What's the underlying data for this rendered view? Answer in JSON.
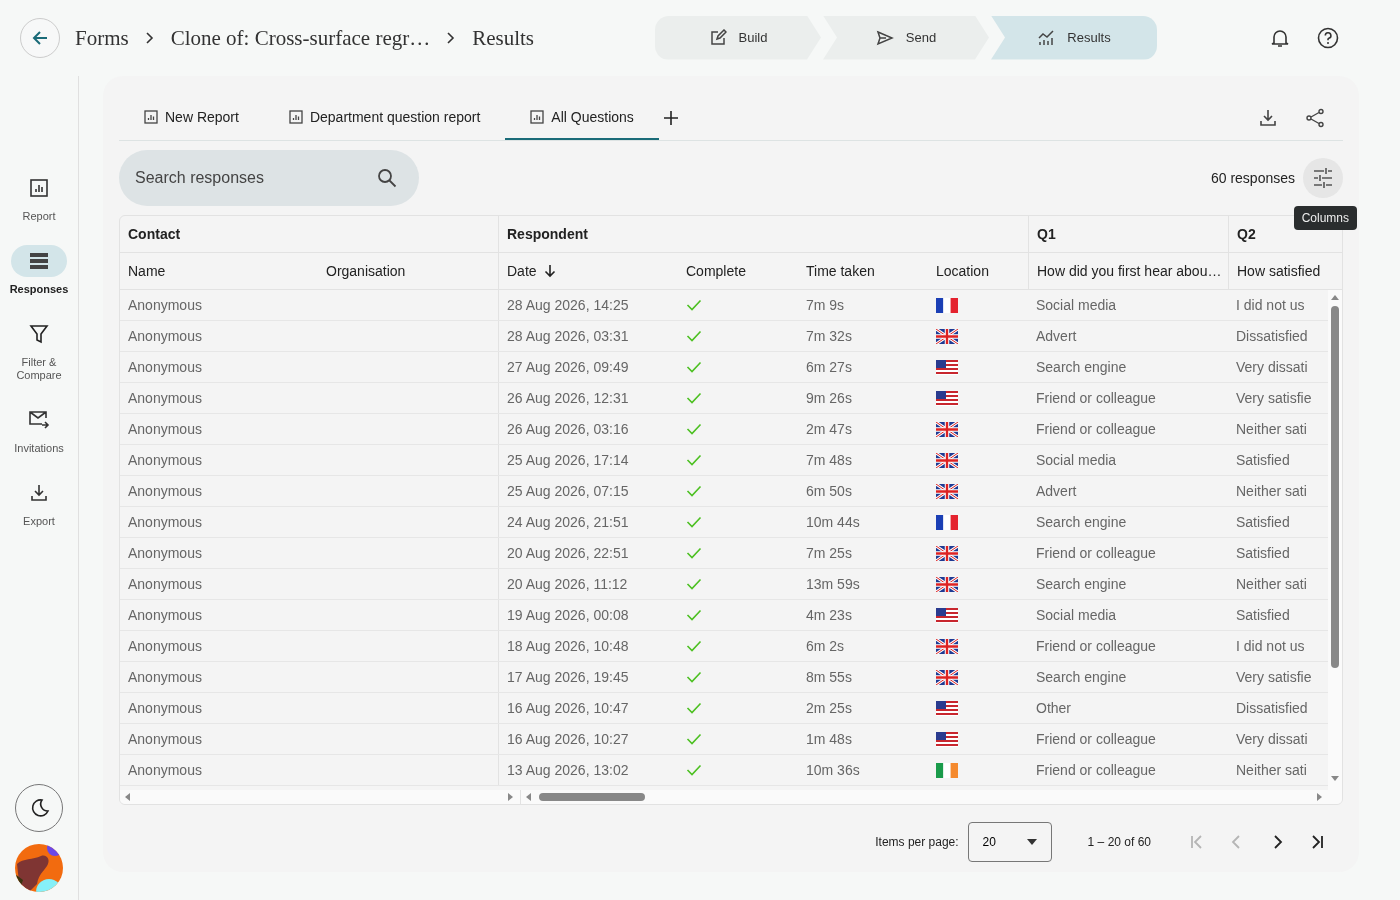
{
  "breadcrumb": [
    "Forms",
    "Clone of: Cross-surface regr…",
    "Results"
  ],
  "steps": [
    {
      "kind": "build",
      "label": "Build",
      "selected": false
    },
    {
      "kind": "send",
      "label": "Send",
      "selected": false
    },
    {
      "kind": "results",
      "label": "Results",
      "selected": true
    }
  ],
  "sidebar": {
    "items": [
      {
        "kind": "report",
        "label": "Report",
        "selected": false
      },
      {
        "kind": "responses",
        "label": "Responses",
        "selected": true
      },
      {
        "kind": "filter",
        "label": "Filter & Compare",
        "selected": false
      },
      {
        "kind": "invitations",
        "label": "Invitations",
        "selected": false
      },
      {
        "kind": "export",
        "label": "Export",
        "selected": false
      }
    ]
  },
  "tabs": [
    {
      "label": "New Report",
      "selected": false
    },
    {
      "label": "Department question report",
      "selected": false
    },
    {
      "label": "All Questions",
      "selected": true
    }
  ],
  "search": {
    "placeholder": "Search responses"
  },
  "response_count": "60 responses",
  "tooltip": "Columns",
  "table": {
    "groups": [
      {
        "label": "Contact"
      },
      {
        "label": "Respondent"
      },
      {
        "label": "Q1"
      },
      {
        "label": "Q2"
      }
    ],
    "columns": [
      {
        "label": "Name",
        "sorted": false
      },
      {
        "label": "Organisation",
        "sorted": false
      },
      {
        "label": "Date",
        "sorted": true
      },
      {
        "label": "Complete",
        "sorted": false
      },
      {
        "label": "Time taken",
        "sorted": false
      },
      {
        "label": "Location",
        "sorted": false
      },
      {
        "label": "How did you first hear abou…",
        "sorted": false
      },
      {
        "label": "How satisfied",
        "sorted": false
      }
    ],
    "rows": [
      {
        "name": "Anonymous",
        "date": "28 Aug 2026, 14:25",
        "complete": true,
        "time": "7m 9s",
        "location": {
          "kind": "fr"
        },
        "q1": "Social media",
        "q2": "I did not us"
      },
      {
        "name": "Anonymous",
        "date": "28 Aug 2026, 03:31",
        "complete": true,
        "time": "7m 32s",
        "location": {
          "kind": "gb"
        },
        "q1": "Advert",
        "q2": "Dissatisfied"
      },
      {
        "name": "Anonymous",
        "date": "27 Aug 2026, 09:49",
        "complete": true,
        "time": "6m 27s",
        "location": {
          "kind": "us"
        },
        "q1": "Search engine",
        "q2": "Very dissati"
      },
      {
        "name": "Anonymous",
        "date": "26 Aug 2026, 12:31",
        "complete": true,
        "time": "9m 26s",
        "location": {
          "kind": "us"
        },
        "q1": "Friend or colleague",
        "q2": "Very satisfie"
      },
      {
        "name": "Anonymous",
        "date": "26 Aug 2026, 03:16",
        "complete": true,
        "time": "2m 47s",
        "location": {
          "kind": "gb"
        },
        "q1": "Friend or colleague",
        "q2": "Neither sati"
      },
      {
        "name": "Anonymous",
        "date": "25 Aug 2026, 17:14",
        "complete": true,
        "time": "7m 48s",
        "location": {
          "kind": "gb"
        },
        "q1": "Social media",
        "q2": "Satisfied"
      },
      {
        "name": "Anonymous",
        "date": "25 Aug 2026, 07:15",
        "complete": true,
        "time": "6m 50s",
        "location": {
          "kind": "gb"
        },
        "q1": "Advert",
        "q2": "Neither sati"
      },
      {
        "name": "Anonymous",
        "date": "24 Aug 2026, 21:51",
        "complete": true,
        "time": "10m 44s",
        "location": {
          "kind": "fr"
        },
        "q1": "Search engine",
        "q2": "Satisfied"
      },
      {
        "name": "Anonymous",
        "date": "20 Aug 2026, 22:51",
        "complete": true,
        "time": "7m 25s",
        "location": {
          "kind": "gb"
        },
        "q1": "Friend or colleague",
        "q2": "Satisfied"
      },
      {
        "name": "Anonymous",
        "date": "20 Aug 2026, 11:12",
        "complete": true,
        "time": "13m 59s",
        "location": {
          "kind": "gb"
        },
        "q1": "Search engine",
        "q2": "Neither sati"
      },
      {
        "name": "Anonymous",
        "date": "19 Aug 2026, 00:08",
        "complete": true,
        "time": "4m 23s",
        "location": {
          "kind": "us"
        },
        "q1": "Social media",
        "q2": "Satisfied"
      },
      {
        "name": "Anonymous",
        "date": "18 Aug 2026, 10:48",
        "complete": true,
        "time": "6m 2s",
        "location": {
          "kind": "gb"
        },
        "q1": "Friend or colleague",
        "q2": "I did not us"
      },
      {
        "name": "Anonymous",
        "date": "17 Aug 2026, 19:45",
        "complete": true,
        "time": "8m 55s",
        "location": {
          "kind": "gb"
        },
        "q1": "Search engine",
        "q2": "Very satisfie"
      },
      {
        "name": "Anonymous",
        "date": "16 Aug 2026, 10:47",
        "complete": true,
        "time": "2m 25s",
        "location": {
          "kind": "us"
        },
        "q1": "Other",
        "q2": "Dissatisfied"
      },
      {
        "name": "Anonymous",
        "date": "16 Aug 2026, 10:27",
        "complete": true,
        "time": "1m 48s",
        "location": {
          "kind": "us"
        },
        "q1": "Friend or colleague",
        "q2": "Very dissati"
      },
      {
        "name": "Anonymous",
        "date": "13 Aug 2026, 13:02",
        "complete": true,
        "time": "10m 36s",
        "location": {
          "kind": "ie"
        },
        "q1": "Friend or colleague",
        "q2": "Neither sati"
      }
    ]
  },
  "pagination": {
    "items_label": "Items per page:",
    "page_size": "20",
    "range": "1 – 20 of 60",
    "buttons": [
      {
        "kind": "first",
        "disabled": true
      },
      {
        "kind": "prev",
        "disabled": true
      },
      {
        "kind": "next",
        "disabled": false
      },
      {
        "kind": "last",
        "disabled": false
      }
    ]
  }
}
